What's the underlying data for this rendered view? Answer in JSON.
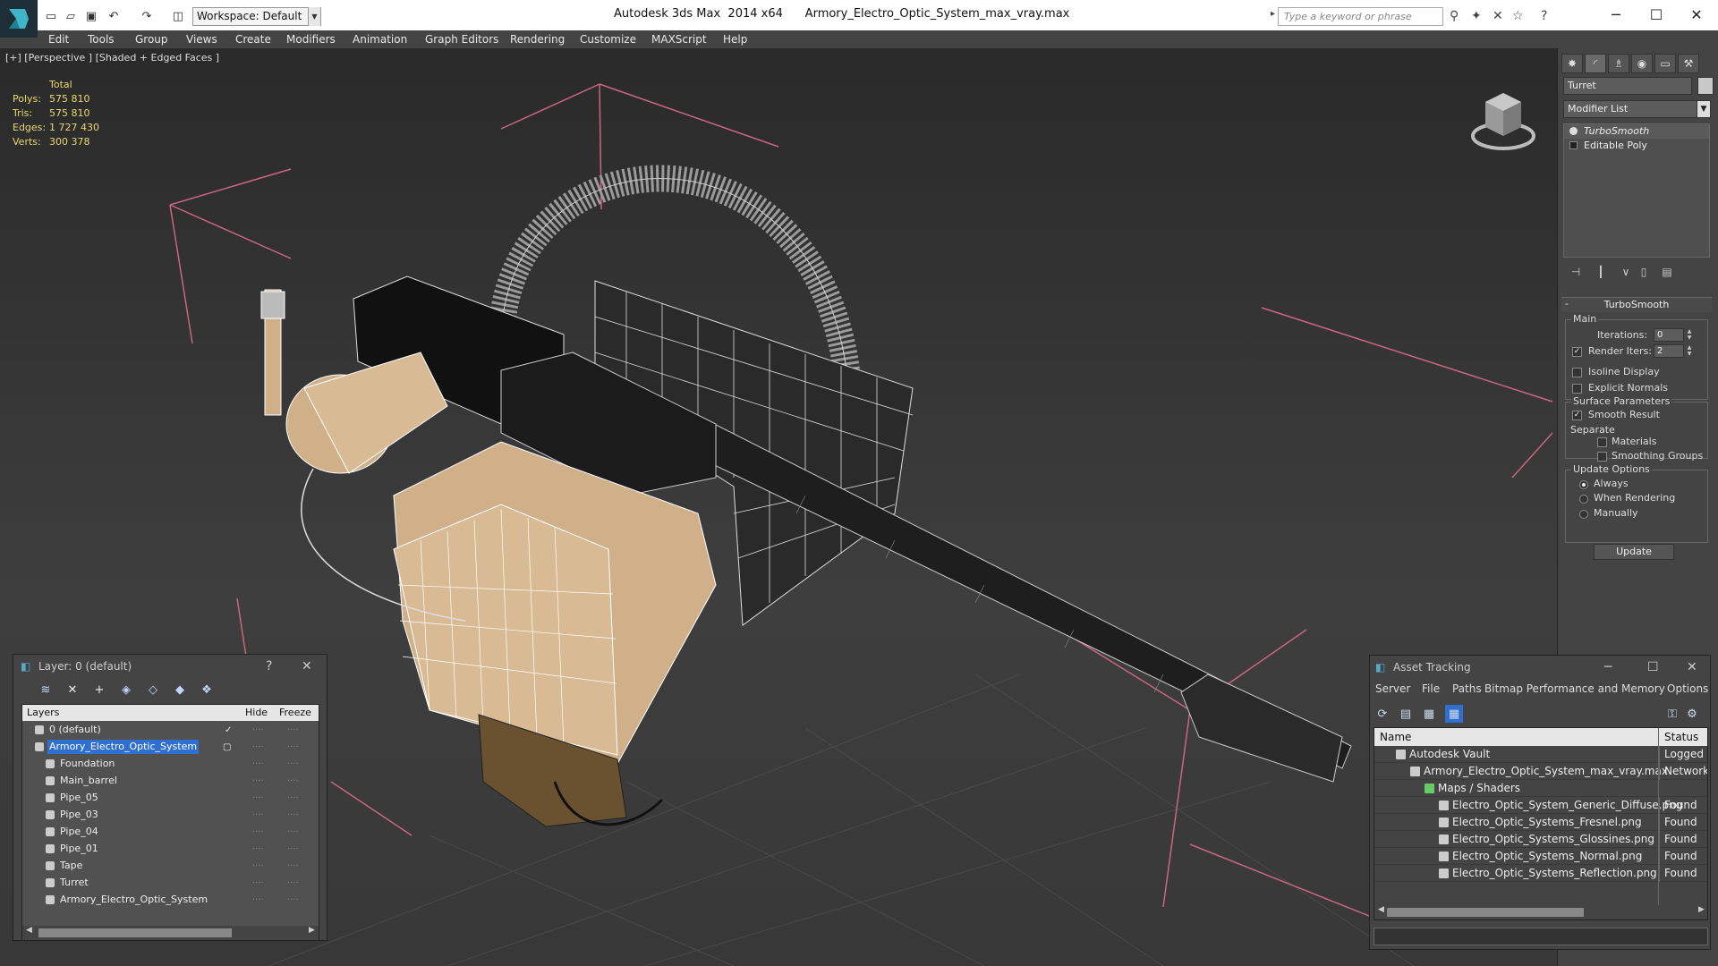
{
  "titlebar": {
    "workspace": "Workspace: Default",
    "title": "Autodesk 3ds Max  2014 x64      Armory_Electro_Optic_System_max_vray.max",
    "search_placeholder": "Type a keyword or phrase"
  },
  "menu": [
    "Edit",
    "Tools",
    "Group",
    "Views",
    "Create",
    "Modifiers",
    "Animation",
    "Graph Editors",
    "Rendering",
    "Customize",
    "MAXScript",
    "Help"
  ],
  "viewport": {
    "label": "[+] [Perspective ] [Shaded + Edged Faces ]",
    "stats_header": "Total",
    "stats": [
      {
        "label": "Polys:",
        "value": "575 810"
      },
      {
        "label": "Tris:",
        "value": "575 810"
      },
      {
        "label": "Edges:",
        "value": "1 727 430"
      },
      {
        "label": "Verts:",
        "value": "300 378"
      }
    ]
  },
  "command_panel": {
    "object_name": "Turret",
    "modifier_list": "Modifier List",
    "stack": [
      "TurboSmooth",
      "Editable Poly"
    ],
    "turbosmooth": {
      "title": "TurboSmooth",
      "main_group": "Main",
      "iterations_label": "Iterations:",
      "iterations": "0",
      "render_iters_label": "Render Iters:",
      "render_iters": "2",
      "isoline": "Isoline Display",
      "explicit": "Explicit Normals",
      "surface_group": "Surface Parameters",
      "smooth_result": "Smooth Result",
      "separate": "Separate",
      "materials": "Materials",
      "smoothing_groups": "Smoothing Groups",
      "update_group": "Update Options",
      "always": "Always",
      "when_rendering": "When Rendering",
      "manually": "Manually",
      "update_button": "Update"
    }
  },
  "layer_panel": {
    "title": "Layer: 0 (default)",
    "help": "?",
    "columns": {
      "layers": "Layers",
      "hide": "Hide",
      "freeze": "Freeze"
    },
    "rows": [
      {
        "name": "0 (default)",
        "level": 0
      },
      {
        "name": "Armory_Electro_Optic_System",
        "level": 0
      },
      {
        "name": "Foundation",
        "level": 1
      },
      {
        "name": "Main_barrel",
        "level": 1
      },
      {
        "name": "Pipe_05",
        "level": 1
      },
      {
        "name": "Pipe_03",
        "level": 1
      },
      {
        "name": "Pipe_04",
        "level": 1
      },
      {
        "name": "Pipe_01",
        "level": 1
      },
      {
        "name": "Tape",
        "level": 1
      },
      {
        "name": "Turret",
        "level": 1
      },
      {
        "name": "Armory_Electro_Optic_System",
        "level": 1
      }
    ]
  },
  "asset_panel": {
    "title": "Asset Tracking",
    "menu": [
      "Server",
      "File",
      "Paths",
      "Bitmap Performance and Memory",
      "Options"
    ],
    "columns": {
      "name": "Name",
      "status": "Status"
    },
    "rows": [
      {
        "name": "Autodesk Vault",
        "status": "Logged Out",
        "level": 0
      },
      {
        "name": "Armory_Electro_Optic_System_max_vray.max",
        "status": "Network Path",
        "level": 1
      },
      {
        "name": "Maps / Shaders",
        "status": "",
        "level": 2
      },
      {
        "name": "Electro_Optic_System_Generic_Diffuse.png",
        "status": "Found",
        "level": 3
      },
      {
        "name": "Electro_Optic_Systems_Fresnel.png",
        "status": "Found",
        "level": 3
      },
      {
        "name": "Electro_Optic_Systems_Glossines.png",
        "status": "Found",
        "level": 3
      },
      {
        "name": "Electro_Optic_Systems_Normal.png",
        "status": "Found",
        "level": 3
      },
      {
        "name": "Electro_Optic_Systems_Reflection.png",
        "status": "Found",
        "level": 3
      }
    ]
  }
}
